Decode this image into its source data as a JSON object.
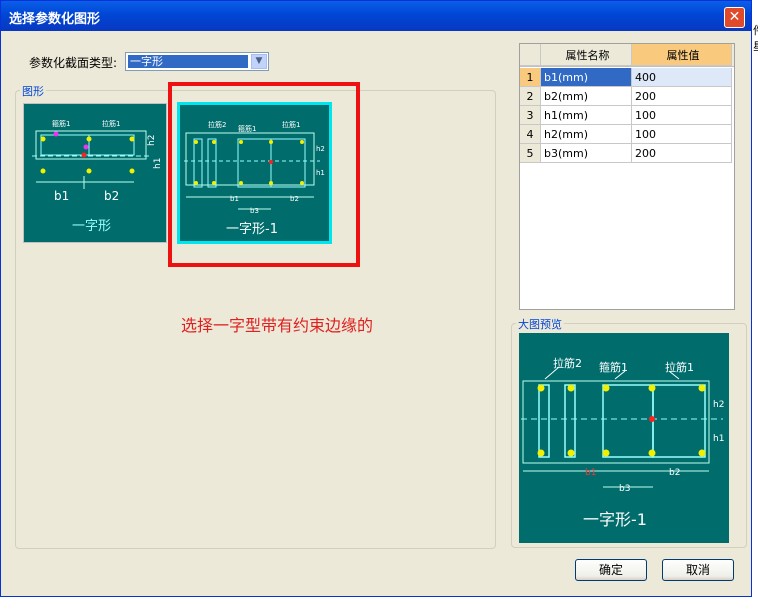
{
  "window": {
    "title": "选择参数化图形",
    "close_glyph": "✕"
  },
  "section_type": {
    "label": "参数化截面类型:",
    "selected_value": "一字形"
  },
  "shapes_group": {
    "title": "图形",
    "items": [
      {
        "name": "一字形",
        "labels": [
          "箍筋1",
          "拉筋1",
          "h2",
          "h1",
          "b1",
          "b2"
        ]
      },
      {
        "name": "一字形-1",
        "labels": [
          "拉筋2",
          "箍筋1",
          "拉筋1",
          "h2",
          "h1",
          "b1",
          "b3",
          "b2"
        ]
      }
    ]
  },
  "annotation": "选择一字型带有约束边缘的",
  "property_table": {
    "headers": [
      "",
      "属性名称",
      "属性值"
    ],
    "rows": [
      {
        "index": "1",
        "name": "b1(mm)",
        "value": "400"
      },
      {
        "index": "2",
        "name": "b2(mm)",
        "value": "200"
      },
      {
        "index": "3",
        "name": "h1(mm)",
        "value": "100"
      },
      {
        "index": "4",
        "name": "h2(mm)",
        "value": "100"
      },
      {
        "index": "5",
        "name": "b3(mm)",
        "value": "200"
      }
    ]
  },
  "preview_group": {
    "title": "大图预览",
    "labels": {
      "tie2": "拉筋2",
      "stirrup1": "箍筋1",
      "tie1": "拉筋1",
      "h2": "h2",
      "h1": "h1",
      "b1": "b1",
      "b2": "b2",
      "b3": "b3",
      "name": "一字形-1"
    }
  },
  "buttons": {
    "ok": "确定",
    "cancel": "取消"
  },
  "background_fragments": [
    "件星"
  ],
  "colors": {
    "diagram_bg": "#006c6c",
    "highlight": "#ee1111",
    "rebar_dot": "#f0f000",
    "selected_row": "#316ac5",
    "header_accent": "#f9c97e"
  }
}
